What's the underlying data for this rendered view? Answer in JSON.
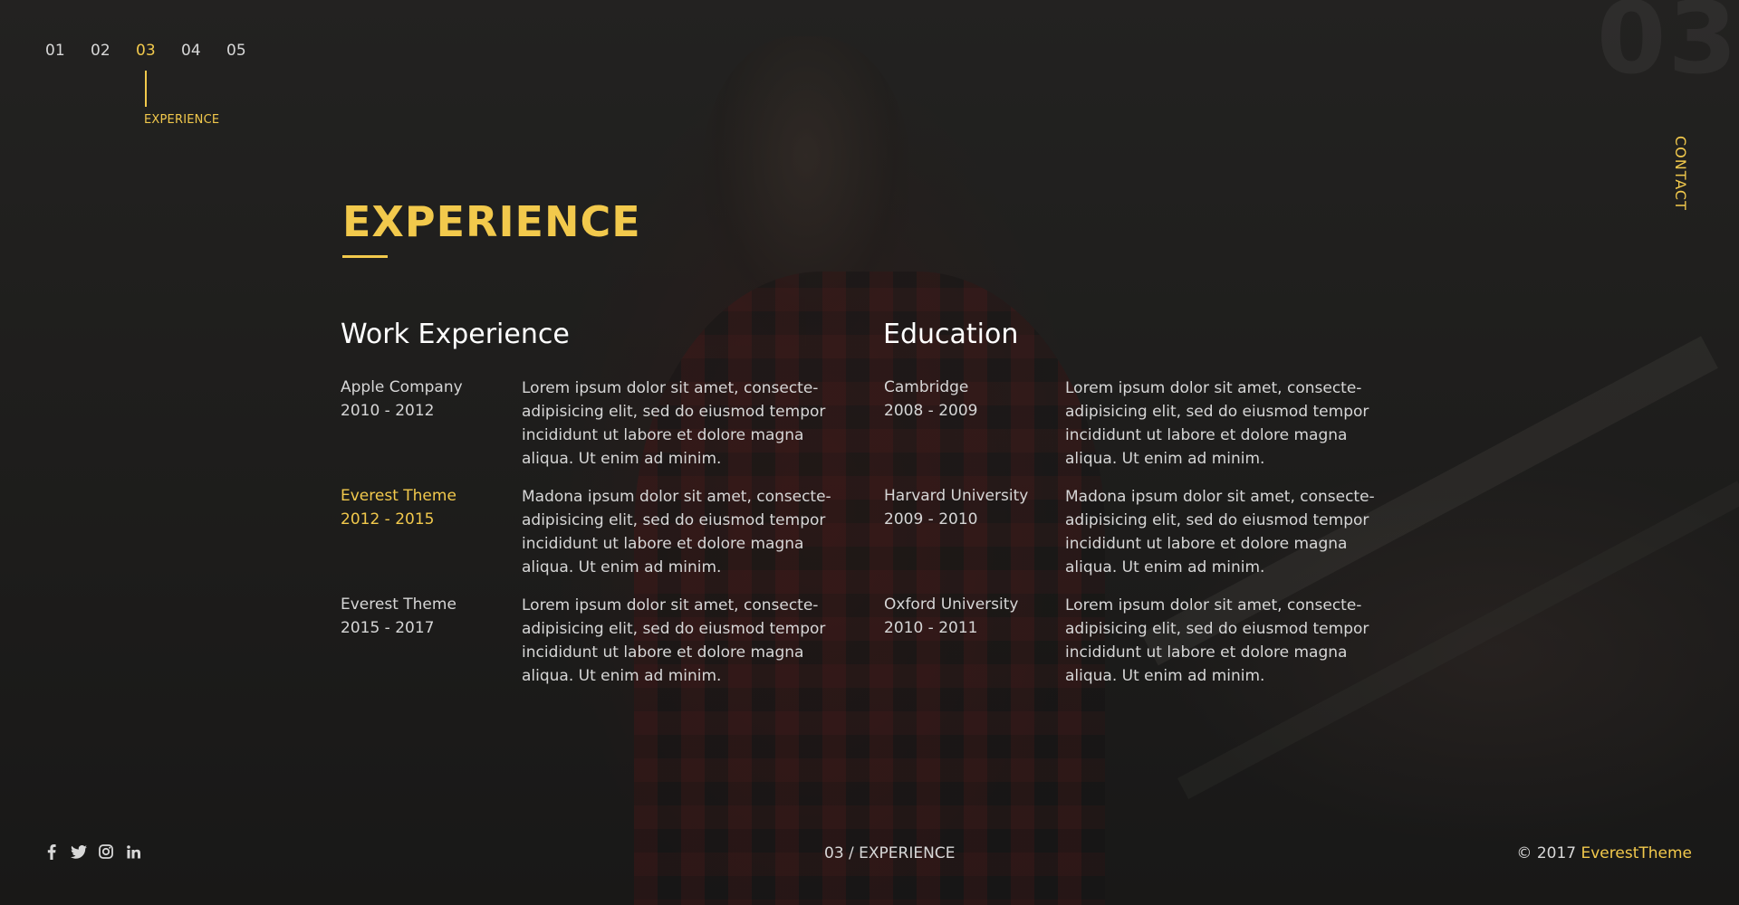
{
  "background_number": "03",
  "nav": {
    "items": [
      "01",
      "02",
      "03",
      "04",
      "05"
    ],
    "active_index": 2,
    "active_caption": "EXPERIENCE"
  },
  "side_link": "CONTACT",
  "section": {
    "title": "EXPERIENCE"
  },
  "work": {
    "heading": "Work Experience",
    "entries": [
      {
        "name": "Apple Company",
        "years": "2010 - 2012",
        "desc": "Lorem ipsum dolor sit amet, consecte- adipisicing elit, sed do eiusmod tempor incididunt ut labore et dolore magna aliqua. Ut enim ad minim."
      },
      {
        "name": "Everest Theme",
        "years": "2012 - 2015",
        "desc": "Madona ipsum dolor sit amet, consecte- adipisicing elit, sed do eiusmod tempor incididunt ut labore et dolore magna aliqua. Ut enim ad minim."
      },
      {
        "name": "Everest Theme",
        "years": "2015 - 2017",
        "desc": "Lorem ipsum dolor sit amet, consecte- adipisicing elit, sed do eiusmod tempor incididunt ut labore et dolore magna aliqua. Ut enim ad minim."
      }
    ]
  },
  "education": {
    "heading": "Education",
    "entries": [
      {
        "name": "Cambridge",
        "years": "2008 - 2009",
        "desc": "Lorem ipsum dolor sit amet, consecte- adipisicing elit, sed do eiusmod tempor incididunt ut labore et dolore magna aliqua. Ut enim ad minim."
      },
      {
        "name": "Harvard University",
        "years": "2009 - 2010",
        "desc": "Madona ipsum dolor sit amet, consecte- adipisicing elit, sed do eiusmod tempor incididunt ut labore et dolore magna aliqua. Ut enim ad minim."
      },
      {
        "name": "Oxford University",
        "years": "2010 - 2011",
        "desc": "Lorem ipsum dolor sit amet, consecte- adipisicing elit, sed do eiusmod tempor incididunt ut labore et dolore magna aliqua. Ut enim ad minim."
      }
    ]
  },
  "social": [
    "facebook-icon",
    "twitter-icon",
    "instagram-icon",
    "linkedin-icon"
  ],
  "footer": {
    "page_indicator": "03 / EXPERIENCE",
    "copyright": "© 2017",
    "brand": "EverestTheme"
  },
  "colors": {
    "accent": "#f2c94c",
    "text": "#d6d6d6",
    "background": "#232220"
  }
}
